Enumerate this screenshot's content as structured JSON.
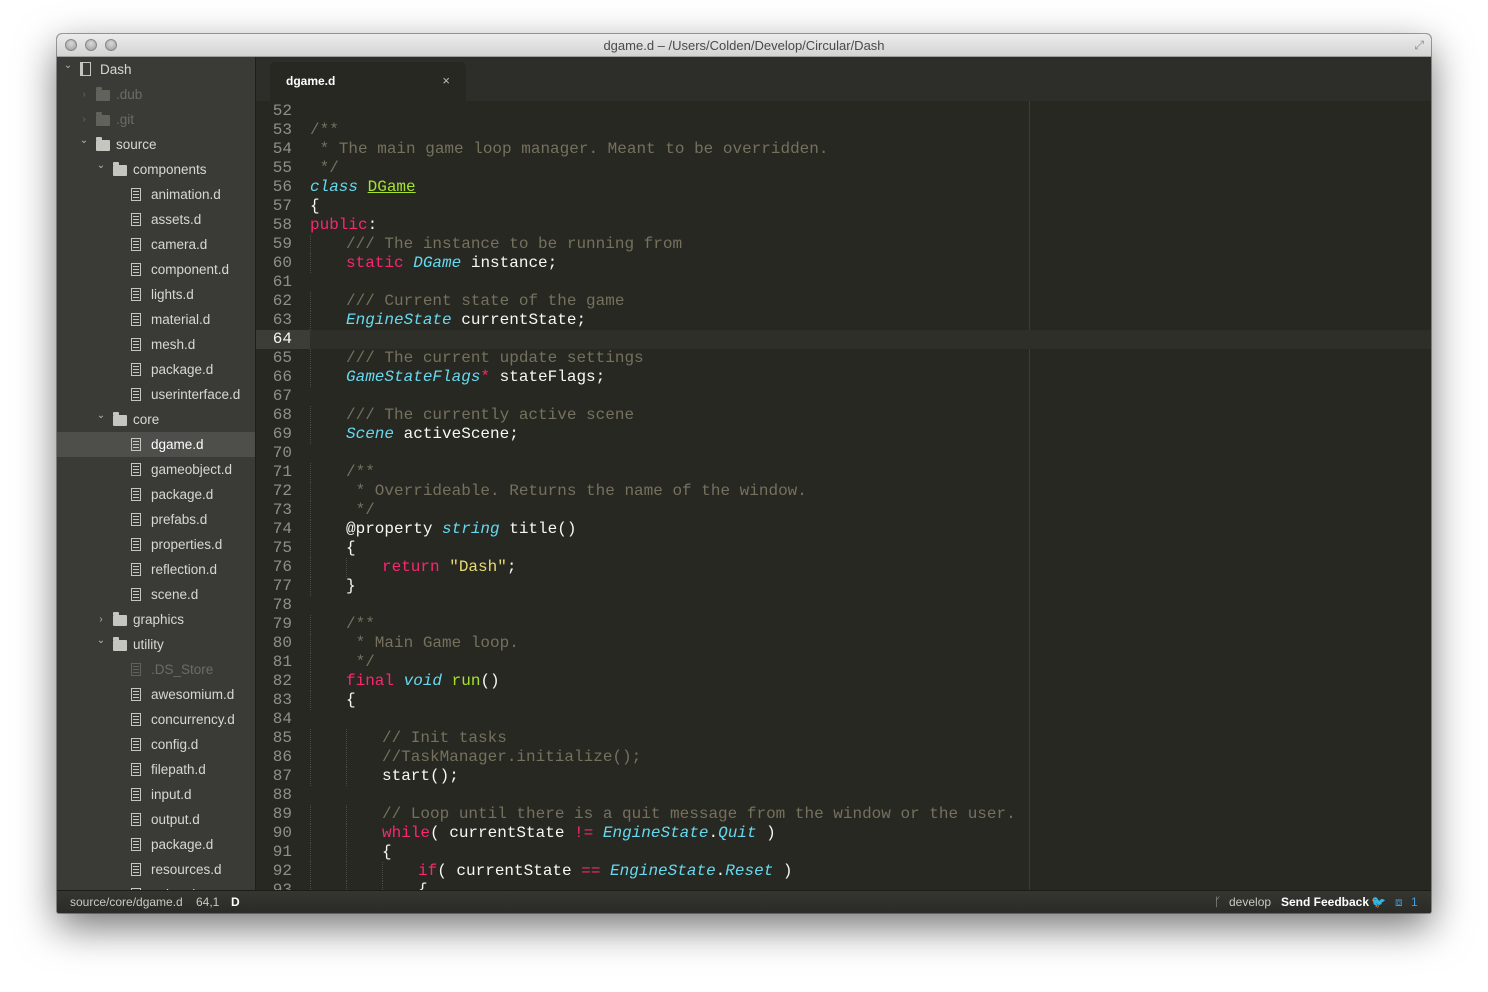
{
  "window": {
    "title": "dgame.d – /Users/Colden/Develop/Circular/Dash"
  },
  "sidebar": {
    "items": [
      {
        "label": "Dash",
        "depth": 0,
        "type": "project",
        "arrow": "down",
        "dim": false
      },
      {
        "label": ".dub",
        "depth": 1,
        "type": "folder",
        "arrow": "right",
        "dim": true
      },
      {
        "label": ".git",
        "depth": 1,
        "type": "folder",
        "arrow": "right",
        "dim": true
      },
      {
        "label": "source",
        "depth": 1,
        "type": "folder",
        "arrow": "down",
        "dim": false
      },
      {
        "label": "components",
        "depth": 2,
        "type": "folder",
        "arrow": "down",
        "dim": false
      },
      {
        "label": "animation.d",
        "depth": 3,
        "type": "file",
        "dim": false
      },
      {
        "label": "assets.d",
        "depth": 3,
        "type": "file",
        "dim": false
      },
      {
        "label": "camera.d",
        "depth": 3,
        "type": "file",
        "dim": false
      },
      {
        "label": "component.d",
        "depth": 3,
        "type": "file",
        "dim": false
      },
      {
        "label": "lights.d",
        "depth": 3,
        "type": "file",
        "dim": false
      },
      {
        "label": "material.d",
        "depth": 3,
        "type": "file",
        "dim": false
      },
      {
        "label": "mesh.d",
        "depth": 3,
        "type": "file",
        "dim": false
      },
      {
        "label": "package.d",
        "depth": 3,
        "type": "file",
        "dim": false
      },
      {
        "label": "userinterface.d",
        "depth": 3,
        "type": "file",
        "dim": false
      },
      {
        "label": "core",
        "depth": 2,
        "type": "folder",
        "arrow": "down",
        "dim": false
      },
      {
        "label": "dgame.d",
        "depth": 3,
        "type": "file",
        "dim": false,
        "selected": true
      },
      {
        "label": "gameobject.d",
        "depth": 3,
        "type": "file",
        "dim": false
      },
      {
        "label": "package.d",
        "depth": 3,
        "type": "file",
        "dim": false
      },
      {
        "label": "prefabs.d",
        "depth": 3,
        "type": "file",
        "dim": false
      },
      {
        "label": "properties.d",
        "depth": 3,
        "type": "file",
        "dim": false
      },
      {
        "label": "reflection.d",
        "depth": 3,
        "type": "file",
        "dim": false
      },
      {
        "label": "scene.d",
        "depth": 3,
        "type": "file",
        "dim": false
      },
      {
        "label": "graphics",
        "depth": 2,
        "type": "folder",
        "arrow": "right",
        "dim": false
      },
      {
        "label": "utility",
        "depth": 2,
        "type": "folder",
        "arrow": "down",
        "dim": false
      },
      {
        "label": ".DS_Store",
        "depth": 3,
        "type": "file",
        "dim": true
      },
      {
        "label": "awesomium.d",
        "depth": 3,
        "type": "file",
        "dim": false
      },
      {
        "label": "concurrency.d",
        "depth": 3,
        "type": "file",
        "dim": false
      },
      {
        "label": "config.d",
        "depth": 3,
        "type": "file",
        "dim": false
      },
      {
        "label": "filepath.d",
        "depth": 3,
        "type": "file",
        "dim": false
      },
      {
        "label": "input.d",
        "depth": 3,
        "type": "file",
        "dim": false
      },
      {
        "label": "output.d",
        "depth": 3,
        "type": "file",
        "dim": false
      },
      {
        "label": "package.d",
        "depth": 3,
        "type": "file",
        "dim": false
      },
      {
        "label": "resources.d",
        "depth": 3,
        "type": "file",
        "dim": false
      },
      {
        "label": "string.d",
        "depth": 3,
        "type": "file",
        "dim": false
      }
    ]
  },
  "tabs": [
    {
      "label": "dgame.d",
      "close": "×"
    }
  ],
  "editor": {
    "current_line": 64,
    "lines": [
      {
        "n": 52,
        "indent": 0,
        "tokens": []
      },
      {
        "n": 53,
        "indent": 0,
        "tokens": [
          {
            "c": "c",
            "t": "/**"
          }
        ]
      },
      {
        "n": 54,
        "indent": 0,
        "tokens": [
          {
            "c": "c",
            "t": " * The main game loop manager. Meant to be overridden."
          }
        ]
      },
      {
        "n": 55,
        "indent": 0,
        "tokens": [
          {
            "c": "c",
            "t": " */"
          }
        ]
      },
      {
        "n": 56,
        "indent": 0,
        "tokens": [
          {
            "c": "t",
            "t": "class"
          },
          {
            "c": "",
            "t": " "
          },
          {
            "c": "cn",
            "t": "DGame"
          }
        ]
      },
      {
        "n": 57,
        "indent": 0,
        "tokens": [
          {
            "c": "",
            "t": "{"
          }
        ]
      },
      {
        "n": 58,
        "indent": 0,
        "tokens": [
          {
            "c": "k",
            "t": "public"
          },
          {
            "c": "",
            "t": ":"
          }
        ]
      },
      {
        "n": 59,
        "indent": 1,
        "tokens": [
          {
            "c": "c",
            "t": "/// The instance to be running from"
          }
        ]
      },
      {
        "n": 60,
        "indent": 1,
        "tokens": [
          {
            "c": "k",
            "t": "static"
          },
          {
            "c": "",
            "t": " "
          },
          {
            "c": "t",
            "t": "DGame"
          },
          {
            "c": "",
            "t": " instance;"
          }
        ]
      },
      {
        "n": 61,
        "indent": 0,
        "tokens": []
      },
      {
        "n": 62,
        "indent": 1,
        "tokens": [
          {
            "c": "c",
            "t": "/// Current state of the game"
          }
        ]
      },
      {
        "n": 63,
        "indent": 1,
        "tokens": [
          {
            "c": "t",
            "t": "EngineState"
          },
          {
            "c": "",
            "t": " currentState;"
          }
        ]
      },
      {
        "n": 64,
        "indent": 0,
        "tokens": []
      },
      {
        "n": 65,
        "indent": 1,
        "tokens": [
          {
            "c": "c",
            "t": "/// The current update settings"
          }
        ]
      },
      {
        "n": 66,
        "indent": 1,
        "tokens": [
          {
            "c": "t",
            "t": "GameStateFlags"
          },
          {
            "c": "k",
            "t": "*"
          },
          {
            "c": "",
            "t": " stateFlags;"
          }
        ]
      },
      {
        "n": 67,
        "indent": 0,
        "tokens": []
      },
      {
        "n": 68,
        "indent": 1,
        "tokens": [
          {
            "c": "c",
            "t": "/// The currently active scene"
          }
        ]
      },
      {
        "n": 69,
        "indent": 1,
        "tokens": [
          {
            "c": "t",
            "t": "Scene"
          },
          {
            "c": "",
            "t": " activeScene;"
          }
        ]
      },
      {
        "n": 70,
        "indent": 0,
        "tokens": []
      },
      {
        "n": 71,
        "indent": 1,
        "tokens": [
          {
            "c": "c",
            "t": "/**"
          }
        ]
      },
      {
        "n": 72,
        "indent": 1,
        "tokens": [
          {
            "c": "c",
            "t": " * Overrideable. Returns the name of the window."
          }
        ]
      },
      {
        "n": 73,
        "indent": 1,
        "tokens": [
          {
            "c": "c",
            "t": " */"
          }
        ]
      },
      {
        "n": 74,
        "indent": 1,
        "tokens": [
          {
            "c": "",
            "t": "@property "
          },
          {
            "c": "t",
            "t": "string"
          },
          {
            "c": "",
            "t": " title()"
          }
        ]
      },
      {
        "n": 75,
        "indent": 1,
        "tokens": [
          {
            "c": "",
            "t": "{"
          }
        ]
      },
      {
        "n": 76,
        "indent": 2,
        "tokens": [
          {
            "c": "k",
            "t": "return"
          },
          {
            "c": "",
            "t": " "
          },
          {
            "c": "s",
            "t": "\"Dash\""
          },
          {
            "c": "",
            "t": ";"
          }
        ]
      },
      {
        "n": 77,
        "indent": 1,
        "tokens": [
          {
            "c": "",
            "t": "}"
          }
        ]
      },
      {
        "n": 78,
        "indent": 0,
        "tokens": []
      },
      {
        "n": 79,
        "indent": 1,
        "tokens": [
          {
            "c": "c",
            "t": "/**"
          }
        ]
      },
      {
        "n": 80,
        "indent": 1,
        "tokens": [
          {
            "c": "c",
            "t": " * Main Game loop."
          }
        ]
      },
      {
        "n": 81,
        "indent": 1,
        "tokens": [
          {
            "c": "c",
            "t": " */"
          }
        ]
      },
      {
        "n": 82,
        "indent": 1,
        "tokens": [
          {
            "c": "k",
            "t": "final"
          },
          {
            "c": "",
            "t": " "
          },
          {
            "c": "t",
            "t": "void"
          },
          {
            "c": "",
            "t": " "
          },
          {
            "c": "fn",
            "t": "run"
          },
          {
            "c": "",
            "t": "()"
          }
        ]
      },
      {
        "n": 83,
        "indent": 1,
        "tokens": [
          {
            "c": "",
            "t": "{"
          }
        ]
      },
      {
        "n": 84,
        "indent": 0,
        "tokens": []
      },
      {
        "n": 85,
        "indent": 2,
        "tokens": [
          {
            "c": "c",
            "t": "// Init tasks"
          }
        ]
      },
      {
        "n": 86,
        "indent": 2,
        "tokens": [
          {
            "c": "c",
            "t": "//TaskManager.initialize();"
          }
        ]
      },
      {
        "n": 87,
        "indent": 2,
        "tokens": [
          {
            "c": "",
            "t": "start();"
          }
        ]
      },
      {
        "n": 88,
        "indent": 0,
        "tokens": []
      },
      {
        "n": 89,
        "indent": 2,
        "tokens": [
          {
            "c": "c",
            "t": "// Loop until there is a quit message from the window or the user."
          }
        ]
      },
      {
        "n": 90,
        "indent": 2,
        "tokens": [
          {
            "c": "k",
            "t": "while"
          },
          {
            "c": "",
            "t": "( currentState "
          },
          {
            "c": "k",
            "t": "!="
          },
          {
            "c": "",
            "t": " "
          },
          {
            "c": "t",
            "t": "EngineState"
          },
          {
            "c": "",
            "t": "."
          },
          {
            "c": "t",
            "t": "Quit"
          },
          {
            "c": "",
            "t": " )"
          }
        ]
      },
      {
        "n": 91,
        "indent": 2,
        "tokens": [
          {
            "c": "",
            "t": "{"
          }
        ]
      },
      {
        "n": 92,
        "indent": 3,
        "tokens": [
          {
            "c": "k",
            "t": "if"
          },
          {
            "c": "",
            "t": "( currentState "
          },
          {
            "c": "k",
            "t": "=="
          },
          {
            "c": "",
            "t": " "
          },
          {
            "c": "t",
            "t": "EngineState"
          },
          {
            "c": "",
            "t": "."
          },
          {
            "c": "t",
            "t": "Reset"
          },
          {
            "c": "",
            "t": " )"
          }
        ]
      },
      {
        "n": 93,
        "indent": 3,
        "tokens": [
          {
            "c": "",
            "t": "{"
          }
        ]
      }
    ]
  },
  "statusbar": {
    "path": "source/core/dgame.d",
    "position": "64,1",
    "syntax": "D",
    "branch": "develop",
    "feedback": "Send Feedback",
    "count": "1"
  },
  "colors": {
    "comment": "#75715e",
    "keyword": "#f92672",
    "type": "#66d9ef",
    "function": "#a6e22e",
    "string": "#e6db74",
    "background": "#272822"
  }
}
